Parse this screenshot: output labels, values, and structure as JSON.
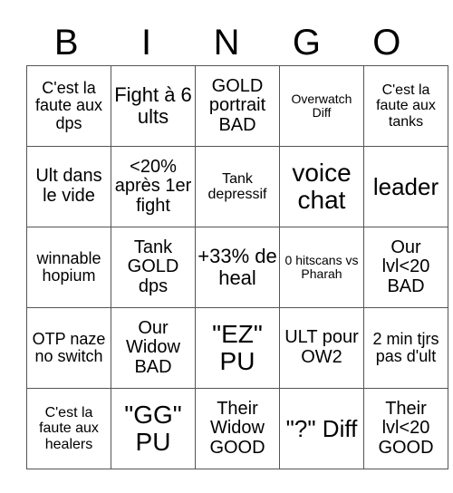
{
  "header": [
    "B",
    "I",
    "N",
    "G",
    "O"
  ],
  "cells": [
    [
      "C'est la faute aux dps",
      "Fight à 6 ults",
      "GOLD portrait BAD",
      "Overwatch Diff",
      "C'est la faute aux tanks"
    ],
    [
      "Ult dans le vide",
      "<20% après 1er fight",
      "Tank depressif",
      "voice chat",
      "leader"
    ],
    [
      "winnable hopium",
      "Tank GOLD dps",
      "+33% de heal",
      "0 hitscans vs Pharah",
      "Our lvl<20 BAD"
    ],
    [
      "OTP naze no switch",
      "Our Widow BAD",
      "\"EZ\" PU",
      "ULT pour OW2",
      "2 min tjrs pas d'ult"
    ],
    [
      "C'est la faute aux healers",
      "\"GG\" PU",
      "Their Widow GOOD",
      "\"?\" Diff",
      "Their lvl<20 GOOD"
    ]
  ]
}
